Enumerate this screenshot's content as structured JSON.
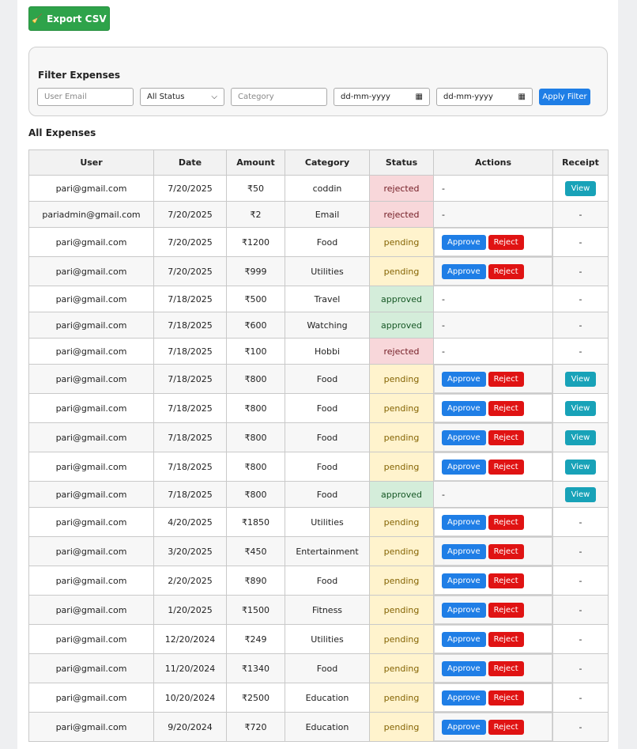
{
  "toolbar": {
    "export_label": "Export CSV",
    "export_icon": "broom-icon"
  },
  "filter": {
    "title": "Filter Expenses",
    "email_placeholder": "User Email",
    "status_selected": "All Status",
    "category_placeholder": "Category",
    "from_date_placeholder": "dd-mm-yyyy",
    "to_date_placeholder": "dd-mm-yyyy",
    "apply_label": "Apply Filter"
  },
  "list_title": "All Expenses",
  "table": {
    "headers": [
      "User",
      "Date",
      "Amount",
      "Category",
      "Status",
      "Actions",
      "Receipt"
    ],
    "approve_label": "Approve",
    "reject_label": "Reject",
    "view_label": "View",
    "empty_label": "-",
    "rows": [
      {
        "user": "pari@gmail.com",
        "date": "7/20/2025",
        "amount": "₹50",
        "category": "coddin",
        "status": "rejected",
        "actions": false,
        "receipt": true,
        "height": 33
      },
      {
        "user": "pariadmin@gmail.com",
        "date": "7/20/2025",
        "amount": "₹2",
        "category": "Email",
        "status": "rejected",
        "actions": false,
        "receipt": false,
        "height": 33
      },
      {
        "user": "pari@gmail.com",
        "date": "7/20/2025",
        "amount": "₹1200",
        "category": "Food",
        "status": "pending",
        "actions": true,
        "receipt": false,
        "height": 37
      },
      {
        "user": "pari@gmail.com",
        "date": "7/20/2025",
        "amount": "₹999",
        "category": "Utilities",
        "status": "pending",
        "actions": true,
        "receipt": false,
        "height": 37
      },
      {
        "user": "pari@gmail.com",
        "date": "7/18/2025",
        "amount": "₹500",
        "category": "Travel",
        "status": "approved",
        "actions": false,
        "receipt": false,
        "height": 33
      },
      {
        "user": "pari@gmail.com",
        "date": "7/18/2025",
        "amount": "₹600",
        "category": "Watching",
        "status": "approved",
        "actions": false,
        "receipt": false,
        "height": 33
      },
      {
        "user": "pari@gmail.com",
        "date": "7/18/2025",
        "amount": "₹100",
        "category": "Hobbi",
        "status": "rejected",
        "actions": false,
        "receipt": false,
        "height": 33
      },
      {
        "user": "pari@gmail.com",
        "date": "7/18/2025",
        "amount": "₹800",
        "category": "Food",
        "status": "pending",
        "actions": true,
        "receipt": true,
        "height": 37
      },
      {
        "user": "pari@gmail.com",
        "date": "7/18/2025",
        "amount": "₹800",
        "category": "Food",
        "status": "pending",
        "actions": true,
        "receipt": true,
        "height": 37
      },
      {
        "user": "pari@gmail.com",
        "date": "7/18/2025",
        "amount": "₹800",
        "category": "Food",
        "status": "pending",
        "actions": true,
        "receipt": true,
        "height": 37
      },
      {
        "user": "pari@gmail.com",
        "date": "7/18/2025",
        "amount": "₹800",
        "category": "Food",
        "status": "pending",
        "actions": true,
        "receipt": true,
        "height": 37
      },
      {
        "user": "pari@gmail.com",
        "date": "7/18/2025",
        "amount": "₹800",
        "category": "Food",
        "status": "approved",
        "actions": false,
        "receipt": true,
        "height": 33
      },
      {
        "user": "pari@gmail.com",
        "date": "4/20/2025",
        "amount": "₹1850",
        "category": "Utilities",
        "status": "pending",
        "actions": true,
        "receipt": false,
        "height": 37
      },
      {
        "user": "pari@gmail.com",
        "date": "3/20/2025",
        "amount": "₹450",
        "category": "Entertainment",
        "status": "pending",
        "actions": true,
        "receipt": false,
        "height": 37
      },
      {
        "user": "pari@gmail.com",
        "date": "2/20/2025",
        "amount": "₹890",
        "category": "Food",
        "status": "pending",
        "actions": true,
        "receipt": false,
        "height": 37
      },
      {
        "user": "pari@gmail.com",
        "date": "1/20/2025",
        "amount": "₹1500",
        "category": "Fitness",
        "status": "pending",
        "actions": true,
        "receipt": false,
        "height": 37
      },
      {
        "user": "pari@gmail.com",
        "date": "12/20/2024",
        "amount": "₹249",
        "category": "Utilities",
        "status": "pending",
        "actions": true,
        "receipt": false,
        "height": 37
      },
      {
        "user": "pari@gmail.com",
        "date": "11/20/2024",
        "amount": "₹1340",
        "category": "Food",
        "status": "pending",
        "actions": true,
        "receipt": false,
        "height": 37
      },
      {
        "user": "pari@gmail.com",
        "date": "10/20/2024",
        "amount": "₹2500",
        "category": "Education",
        "status": "pending",
        "actions": true,
        "receipt": false,
        "height": 37
      },
      {
        "user": "pari@gmail.com",
        "date": "9/20/2024",
        "amount": "₹720",
        "category": "Education",
        "status": "pending",
        "actions": true,
        "receipt": false,
        "height": 37
      }
    ]
  },
  "colors": {
    "export_green": "#2ea34a",
    "approve_blue": "#1f7ee6",
    "reject_red": "#e01313",
    "view_teal": "#18a2b8",
    "rejected_bg": "#f8d7da",
    "pending_bg": "#fff3cd",
    "approved_bg": "#d4edda"
  }
}
